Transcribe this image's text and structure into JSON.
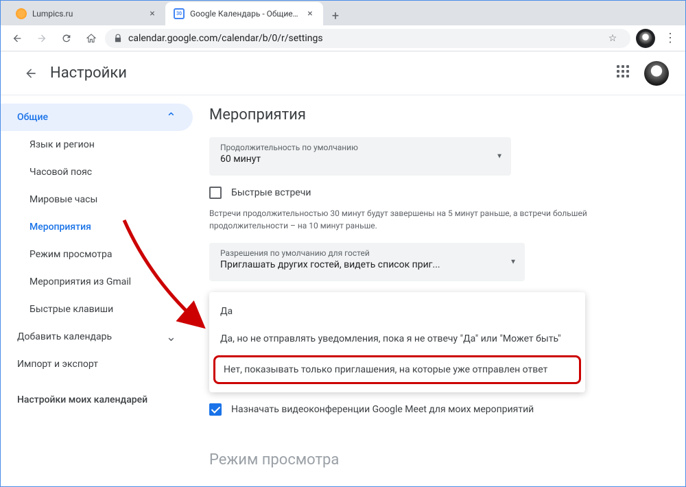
{
  "window": {
    "tabs": [
      {
        "title": "Lumpics.ru",
        "active": false
      },
      {
        "title": "Google Календарь - Общие нас",
        "active": true
      }
    ],
    "url": "calendar.google.com/calendar/b/0/r/settings"
  },
  "header": {
    "title": "Настройки"
  },
  "sidebar": {
    "expanded": "Общие",
    "items": [
      "Язык и регион",
      "Часовой пояс",
      "Мировые часы",
      "Мероприятия",
      "Режим просмотра",
      "Мероприятия из Gmail",
      "Быстрые клавиши"
    ],
    "active_index": 3,
    "top_level": [
      "Добавить календарь",
      "Импорт и экспорт"
    ],
    "section_header": "Настройки моих календарей"
  },
  "main": {
    "section_title": "Мероприятия",
    "duration": {
      "label": "Продолжительность по умолчанию",
      "value": "60 минут"
    },
    "speedy_label": "Быстрые встречи",
    "speedy_hint": "Встречи продолжительностью 30 минут будут завершены на 5 минут раньше, а встречи большей продолжительности – на 10 минут раньше.",
    "guest_perm": {
      "label": "Разрешения по умолчанию для гостей",
      "value": "Приглашать других гостей, видеть список приг..."
    },
    "invite_options": [
      "Да",
      "Да, но не отправлять уведомления, пока я не отвечу \"Да\" или \"Может быть\"",
      "Нет, показывать только приглашения, на которые уже отправлен ответ"
    ],
    "meet_label": "Назначать видеоконференции Google Meet для моих мероприятий",
    "next_section": "Режим просмотра"
  }
}
